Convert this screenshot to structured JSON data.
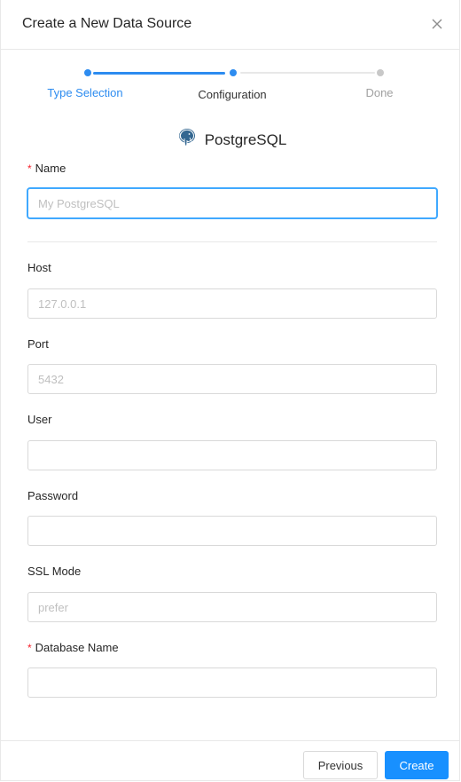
{
  "dialog": {
    "title": "Create a New Data Source",
    "close_icon": "close-icon"
  },
  "steps": [
    {
      "label": "Type Selection",
      "state": "done",
      "color": "#2d8cf0"
    },
    {
      "label": "Configuration",
      "state": "current",
      "color": "#333333"
    },
    {
      "label": "Done",
      "state": "pending",
      "color": "#a0a0a0"
    }
  ],
  "datasource": {
    "icon": "postgresql-elephant-icon",
    "name": "PostgreSQL"
  },
  "form": {
    "name": {
      "label": "Name",
      "required": true,
      "placeholder": "My PostgreSQL",
      "value": ""
    },
    "host": {
      "label": "Host",
      "placeholder": "127.0.0.1",
      "value": ""
    },
    "port": {
      "label": "Port",
      "placeholder": "5432",
      "value": ""
    },
    "user": {
      "label": "User",
      "placeholder": "",
      "value": ""
    },
    "password": {
      "label": "Password",
      "placeholder": "",
      "value": ""
    },
    "ssl_mode": {
      "label": "SSL Mode",
      "placeholder": "prefer",
      "value": ""
    },
    "database_name": {
      "label": "Database Name",
      "required": true,
      "placeholder": "",
      "value": ""
    }
  },
  "footer": {
    "previous_label": "Previous",
    "create_label": "Create"
  },
  "colors": {
    "accent": "#1890ff",
    "required": "#f5222d",
    "step_active": "#2d8cf0",
    "step_pending": "#c8c8c8"
  }
}
